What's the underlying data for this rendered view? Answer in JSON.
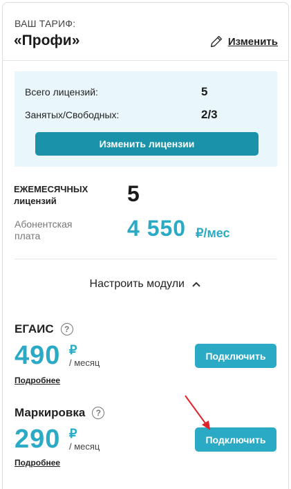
{
  "tariff": {
    "caption": "ВАШ ТАРИФ:",
    "name": "«Профи»",
    "edit_label": "Изменить",
    "edit_icon": "pencil-icon"
  },
  "licenses": {
    "total_label": "Всего лицензий:",
    "total_value": "5",
    "used_free_label": "Занятых/Свободных:",
    "used_free_value": "2/3",
    "change_button": "Изменить лицензии"
  },
  "monthly": {
    "label": "ЕЖЕМЕСЯЧНЫХ лицензий",
    "count": "5"
  },
  "fee": {
    "label": "Абонентская плата",
    "amount": "4 550",
    "unit": "₽/мес"
  },
  "modules": {
    "toggle_label": "Настроить модули",
    "toggle_icon": "chevron-up-icon",
    "items": [
      {
        "title": "ЕГАИС",
        "price": "490",
        "currency": "₽",
        "period": "/ месяц",
        "more": "Подробнее",
        "button": "Подключить"
      },
      {
        "title": "Маркировка",
        "price": "290",
        "currency": "₽",
        "period": "/ месяц",
        "more": "Подробнее",
        "button": "Подключить"
      }
    ]
  },
  "colors": {
    "accent": "#2aaac4",
    "button_dark": "#1a92a9",
    "license_bg": "#e9f6fb",
    "annotation_arrow": "#e0222a"
  }
}
